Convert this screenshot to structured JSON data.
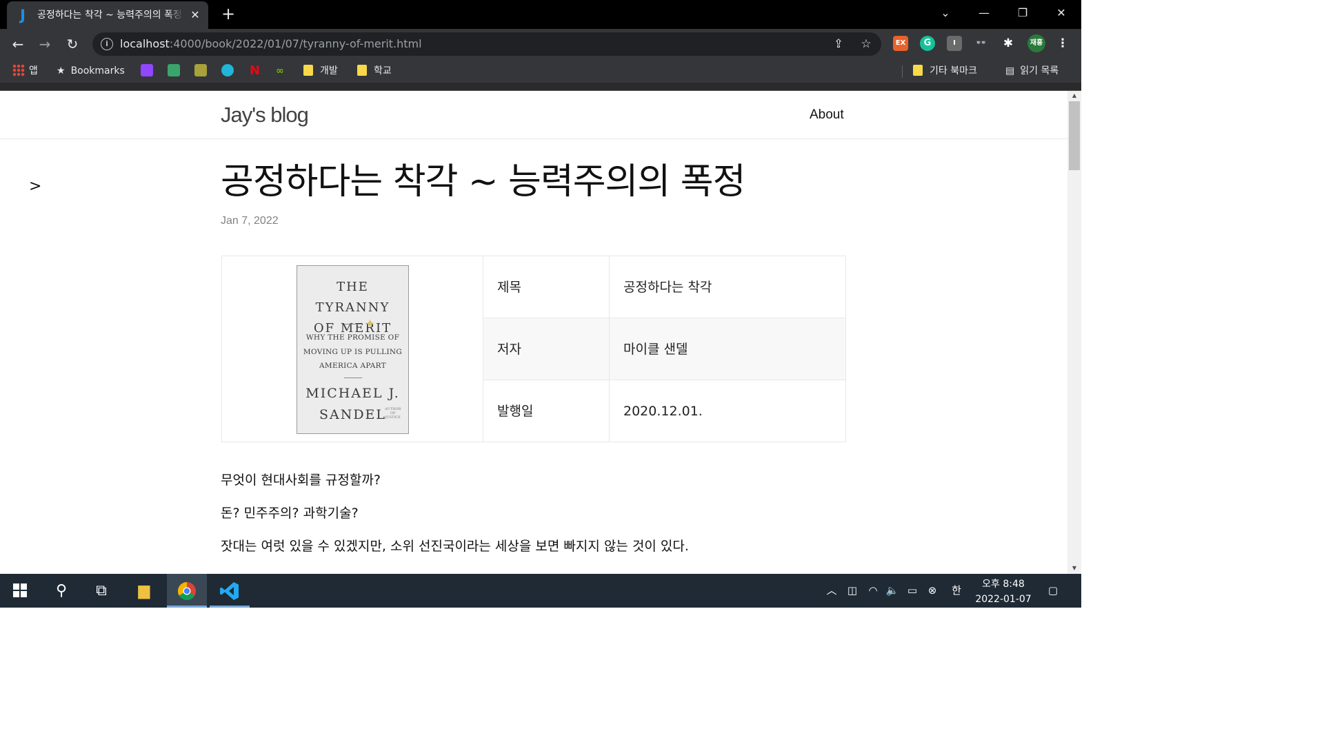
{
  "browser": {
    "tab_title": "공정하다는 착각 ~ 능력주의의 폭정",
    "tab_favicon": "J",
    "url_host": "localhost",
    "url_path": ":4000/book/2022/01/07/tyranny-of-merit.html",
    "bookmarks": [
      {
        "label": "앱",
        "icon": "apps-grid-icon"
      },
      {
        "label": "Bookmarks",
        "icon": "star-icon"
      },
      {
        "label": "",
        "icon": "twitch-icon"
      },
      {
        "label": "",
        "icon": "site-icon"
      },
      {
        "label": "",
        "icon": "site-icon"
      },
      {
        "label": "",
        "icon": "site-icon"
      },
      {
        "label": "",
        "icon": "netflix-icon"
      },
      {
        "label": "",
        "icon": "site-icon"
      },
      {
        "label": "개발",
        "icon": "folder-icon"
      },
      {
        "label": "학교",
        "icon": "folder-icon"
      }
    ],
    "other_bookmarks": "기타 북마크",
    "reading_list": "읽기 목록",
    "profile_label": "재홍",
    "accent_color": "#1e8fe3"
  },
  "site": {
    "title": "Jay's blog",
    "nav_about": "About",
    "toc_toggle": ">"
  },
  "post": {
    "title": "공정하다는 착각 ~ 능력주의의 폭정",
    "date": "Jan 7, 2022",
    "cover": {
      "title": "THE TYRANNY\nOF MERIT",
      "subtitle": "WHY THE PROMISE OF\nMOVING UP IS PULLING\nAMERICA APART",
      "author": "MICHAEL J.\nSANDEL",
      "badge": "AUTHOR\nOF\nJUSTICE"
    },
    "info": [
      {
        "label": "제목",
        "value": "공정하다는 착각"
      },
      {
        "label": "저자",
        "value": "마이클 샌델"
      },
      {
        "label": "발행일",
        "value": "2020.12.01."
      }
    ],
    "paragraphs": [
      "무엇이 현대사회를 규정할까?",
      "돈? 민주주의? 과학기술?",
      "잣대는 여럿 있을 수 있겠지만, 소위 선진국이라는 세상을 보면 빠지지 않는 것이 있다."
    ]
  },
  "taskbar": {
    "clock_time": "오후 8:48",
    "clock_date": "2022-01-07",
    "ime_label": "한"
  }
}
